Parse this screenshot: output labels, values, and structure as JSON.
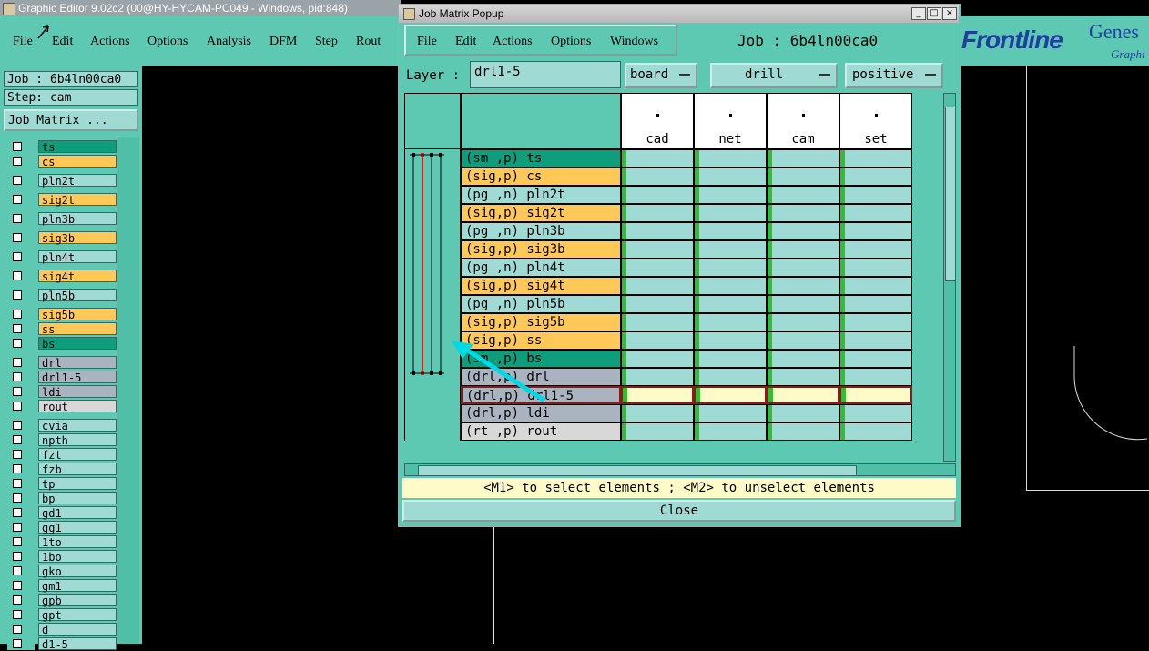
{
  "main_window": {
    "title": "Graphic Editor 9.02c2 (00@HY-HYCAM-PC049 - Windows, pid:848)",
    "menu": [
      "File",
      "Edit",
      "Actions",
      "Options",
      "Analysis",
      "DFM",
      "Step",
      "Rout"
    ]
  },
  "brand": {
    "frontline": "Frontline",
    "genesis": "Genes",
    "graphi": "Graphi"
  },
  "left_panel": {
    "job": "Job : 6b4ln00ca0",
    "step": "Step: cam",
    "job_matrix_button": "Job Matrix ...",
    "layers": [
      {
        "name": "ts",
        "color": "#0e9e7c"
      },
      {
        "name": "cs",
        "color": "#ffc857"
      },
      {
        "name": "pln2t",
        "color": "#9fdad5"
      },
      {
        "name": "sig2t",
        "color": "#ffc857"
      },
      {
        "name": "pln3b",
        "color": "#9fdad5"
      },
      {
        "name": "sig3b",
        "color": "#ffc857"
      },
      {
        "name": "pln4t",
        "color": "#9fdad5"
      },
      {
        "name": "sig4t",
        "color": "#ffc857"
      },
      {
        "name": "pln5b",
        "color": "#9fdad5"
      },
      {
        "name": "sig5b",
        "color": "#ffc857"
      },
      {
        "name": "ss",
        "color": "#ffc857"
      },
      {
        "name": "bs",
        "color": "#0e9e7c"
      },
      {
        "name": "drl",
        "color": "#a9b4c0"
      },
      {
        "name": "drl1-5",
        "color": "#a9b4c0"
      },
      {
        "name": "ldi",
        "color": "#a9b4c0"
      },
      {
        "name": "rout",
        "color": "#d8d8d8"
      },
      {
        "name": "cvia",
        "color": "#9fdad5"
      },
      {
        "name": "npth",
        "color": "#9fdad5"
      },
      {
        "name": "fzt",
        "color": "#9fdad5"
      },
      {
        "name": "fzb",
        "color": "#9fdad5"
      },
      {
        "name": "tp",
        "color": "#9fdad5"
      },
      {
        "name": "bp",
        "color": "#9fdad5"
      },
      {
        "name": "gd1",
        "color": "#9fdad5"
      },
      {
        "name": "gg1",
        "color": "#9fdad5"
      },
      {
        "name": "1to",
        "color": "#9fdad5"
      },
      {
        "name": "1bo",
        "color": "#9fdad5"
      },
      {
        "name": "gko",
        "color": "#9fdad5"
      },
      {
        "name": "gm1",
        "color": "#9fdad5"
      },
      {
        "name": "gpb",
        "color": "#9fdad5"
      },
      {
        "name": "gpt",
        "color": "#9fdad5"
      },
      {
        "name": "d",
        "color": "#9fdad5"
      },
      {
        "name": "d1-5",
        "color": "#9fdad5"
      }
    ]
  },
  "popup": {
    "title": "Job Matrix Popup",
    "menu": [
      "File",
      "Edit",
      "Actions",
      "Options",
      "Windows"
    ],
    "job_label": "Job  :  6b4ln00ca0",
    "layer_label": "Layer :",
    "layer_value": "drl1-5",
    "context": "board",
    "type": "drill",
    "polarity": "positive",
    "steps": [
      "cad",
      "net",
      "cam",
      "set"
    ],
    "rows": [
      {
        "label": "(sm ,p) ts",
        "color": "#0e9e7c"
      },
      {
        "label": "(sig,p) cs",
        "color": "#ffc857"
      },
      {
        "label": "(pg ,n) pln2t",
        "color": "#9fdad5"
      },
      {
        "label": "(sig,p) sig2t",
        "color": "#ffc857"
      },
      {
        "label": "(pg ,n) pln3b",
        "color": "#9fdad5"
      },
      {
        "label": "(sig,p) sig3b",
        "color": "#ffc857"
      },
      {
        "label": "(pg ,n) pln4t",
        "color": "#9fdad5"
      },
      {
        "label": "(sig,p) sig4t",
        "color": "#ffc857"
      },
      {
        "label": "(pg ,n) pln5b",
        "color": "#9fdad5"
      },
      {
        "label": "(sig,p) sig5b",
        "color": "#ffc857"
      },
      {
        "label": "(sig,p) ss",
        "color": "#ffc857"
      },
      {
        "label": "(sm ,p) bs",
        "color": "#0e9e7c"
      },
      {
        "label": "(drl,p) drl",
        "color": "#a9b4c0"
      },
      {
        "label": "(drl,p) drl1-5",
        "color": "#a9b4c0"
      },
      {
        "label": "(drl,p) ldi",
        "color": "#a9b4c0"
      },
      {
        "label": "(rt ,p) rout",
        "color": "#d8d8d8"
      }
    ],
    "selected_row": 13,
    "hint": "<M1> to select elements ; <M2> to unselect elements",
    "close": "Close"
  }
}
